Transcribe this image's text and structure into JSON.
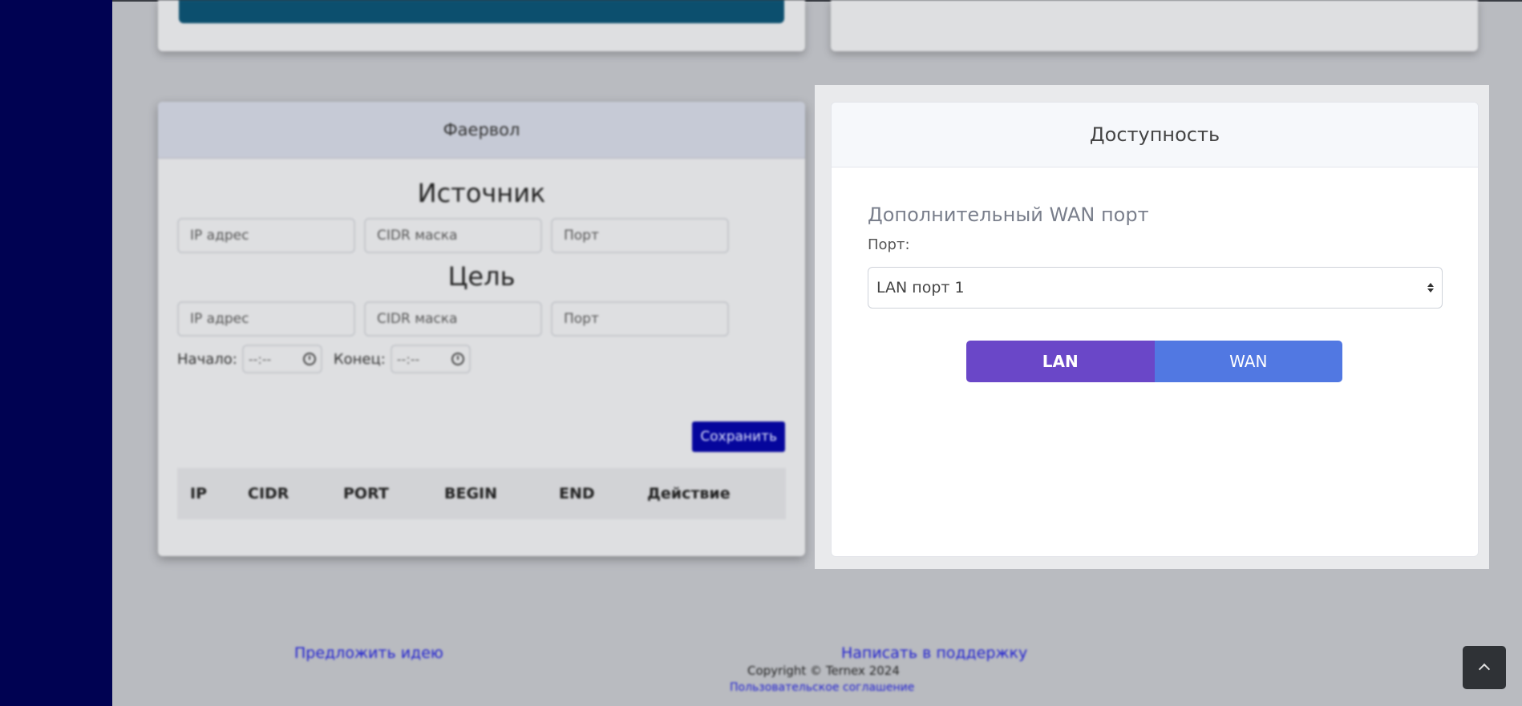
{
  "firewall": {
    "title": "Фаервол",
    "source_heading": "Источник",
    "target_heading": "Цель",
    "ip_placeholder": "IP адрес",
    "cidr_placeholder": "CIDR маска",
    "port_placeholder": "Порт",
    "start_label": "Начало:",
    "end_label": "Конец:",
    "time_placeholder": "--:--",
    "save_label": "Сохранить",
    "table_headers": [
      "IP",
      "CIDR",
      "PORT",
      "BEGIN",
      "END",
      "Действие"
    ]
  },
  "availability": {
    "title": "Доступность",
    "section_title": "Дополнительный WAN порт",
    "port_label": "Порт:",
    "port_selected": "LAN порт 1",
    "lan_label": "LAN",
    "wan_label": "WAN"
  },
  "footer": {
    "suggest_idea": "Предложить идею",
    "write_support": "Написать в поддержку",
    "copyright": "Copyright © Ternex 2024",
    "user_agreement": "Пользовательское соглашение"
  },
  "colors": {
    "sidebar": "#000252",
    "lan_active": "#6a47c8",
    "wan": "#5178e2",
    "save_button": "#05069c"
  }
}
